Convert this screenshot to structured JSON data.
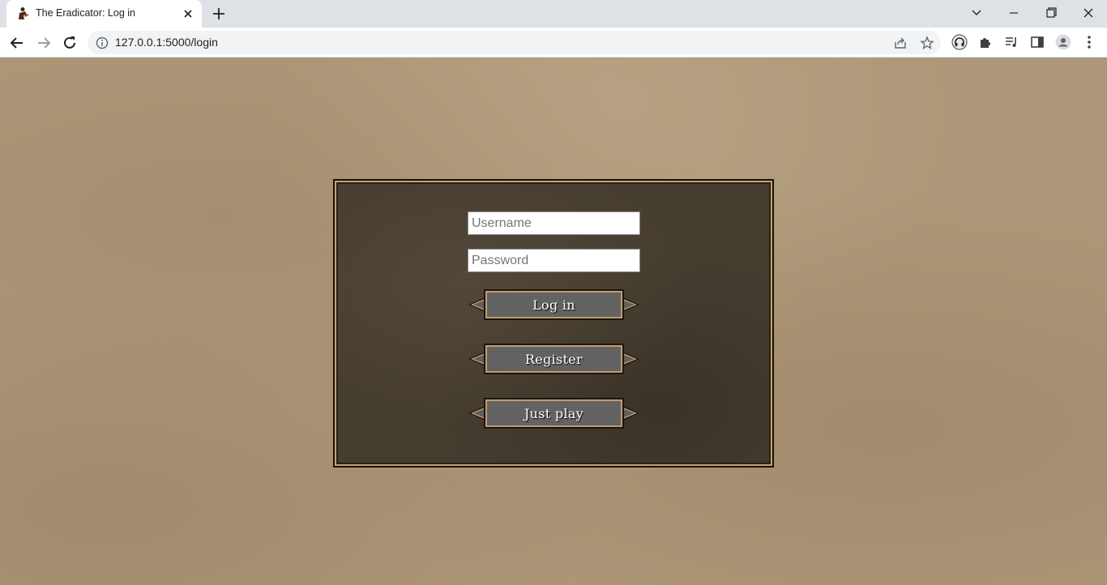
{
  "browser": {
    "tab_title": "The Eradicator: Log in",
    "url": "127.0.0.1:5000/login",
    "icons": [
      "favicon",
      "close-icon",
      "plus-icon",
      "chevron-down-icon",
      "minimize-icon",
      "restore-icon",
      "window-close-icon",
      "back-arrow-icon",
      "forward-arrow-icon",
      "reload-icon",
      "info-icon",
      "share-icon",
      "star-icon",
      "extension-headphones-icon",
      "puzzle-icon",
      "media-queue-icon",
      "side-panel-icon",
      "profile-avatar-icon",
      "kebab-menu-icon"
    ]
  },
  "login_form": {
    "username_placeholder": "Username",
    "username_value": "",
    "password_placeholder": "Password",
    "password_value": "",
    "login_label": "Log in",
    "register_label": "Register",
    "just_play_label": "Just play"
  },
  "colors": {
    "page_background": "#ad9778",
    "panel_background": "#463d31",
    "panel_border_gold": "#c9a070",
    "button_face": "#626262",
    "button_text": "#ffffff"
  }
}
